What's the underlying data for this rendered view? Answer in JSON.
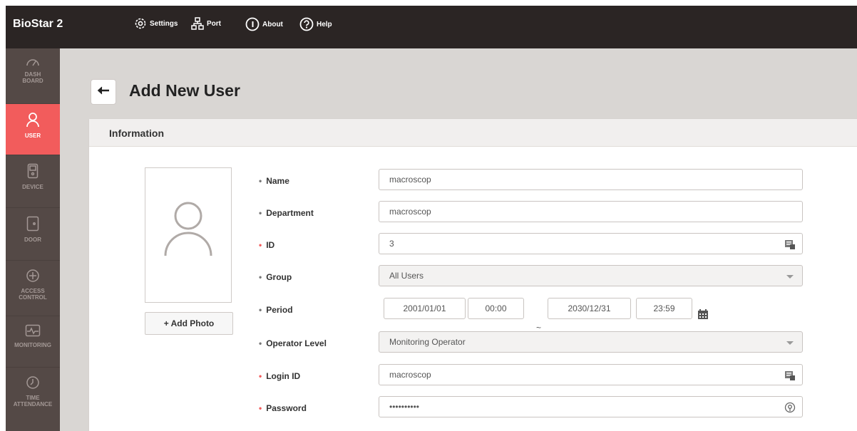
{
  "app": {
    "title": "BioStar 2"
  },
  "topnav": [
    {
      "label": "Settings",
      "icon": "gear-icon"
    },
    {
      "label": "Port",
      "icon": "network-icon"
    },
    {
      "label": "About",
      "icon": "info-icon"
    },
    {
      "label": "Help",
      "icon": "help-icon"
    }
  ],
  "sidebar": {
    "items": [
      {
        "label_lines": [
          "DASH",
          "BOARD"
        ],
        "icon": "gauge-icon",
        "active": false
      },
      {
        "label_lines": [
          "USER"
        ],
        "icon": "user-icon",
        "active": true
      },
      {
        "label_lines": [
          "DEVICE"
        ],
        "icon": "device-icon",
        "active": false
      },
      {
        "label_lines": [
          "DOOR"
        ],
        "icon": "door-icon",
        "active": false
      },
      {
        "label_lines": [
          "ACCESS",
          "CONTROL"
        ],
        "icon": "access-control-icon",
        "active": false
      },
      {
        "label_lines": [
          "MONITORING"
        ],
        "icon": "monitoring-icon",
        "active": false
      },
      {
        "label_lines": [
          "TIME",
          "ATTENDANCE"
        ],
        "icon": "clock-icon",
        "active": false
      }
    ]
  },
  "page": {
    "title": "Add New User"
  },
  "card": {
    "title": "Information"
  },
  "photo": {
    "add_label": "+ Add Photo"
  },
  "form": {
    "name": {
      "label": "Name",
      "value": "macroscop"
    },
    "department": {
      "label": "Department",
      "value": "macroscop"
    },
    "id": {
      "label": "ID",
      "value": "3"
    },
    "group": {
      "label": "Group",
      "value": "All Users"
    },
    "period": {
      "label": "Period",
      "start_date": "2001/01/01",
      "start_time": "00:00",
      "separator": "~",
      "end_date": "2030/12/31",
      "end_time": "23:59"
    },
    "operator_level": {
      "label": "Operator Level",
      "value": "Monitoring Operator"
    },
    "login_id": {
      "label": "Login ID",
      "value": "macroscop"
    },
    "password": {
      "label": "Password",
      "value": "••••••••••"
    }
  },
  "colors": {
    "accent": "#f25c5c",
    "topbar": "#2b2524",
    "sidebar": "#544946",
    "background": "#d9d6d3"
  }
}
